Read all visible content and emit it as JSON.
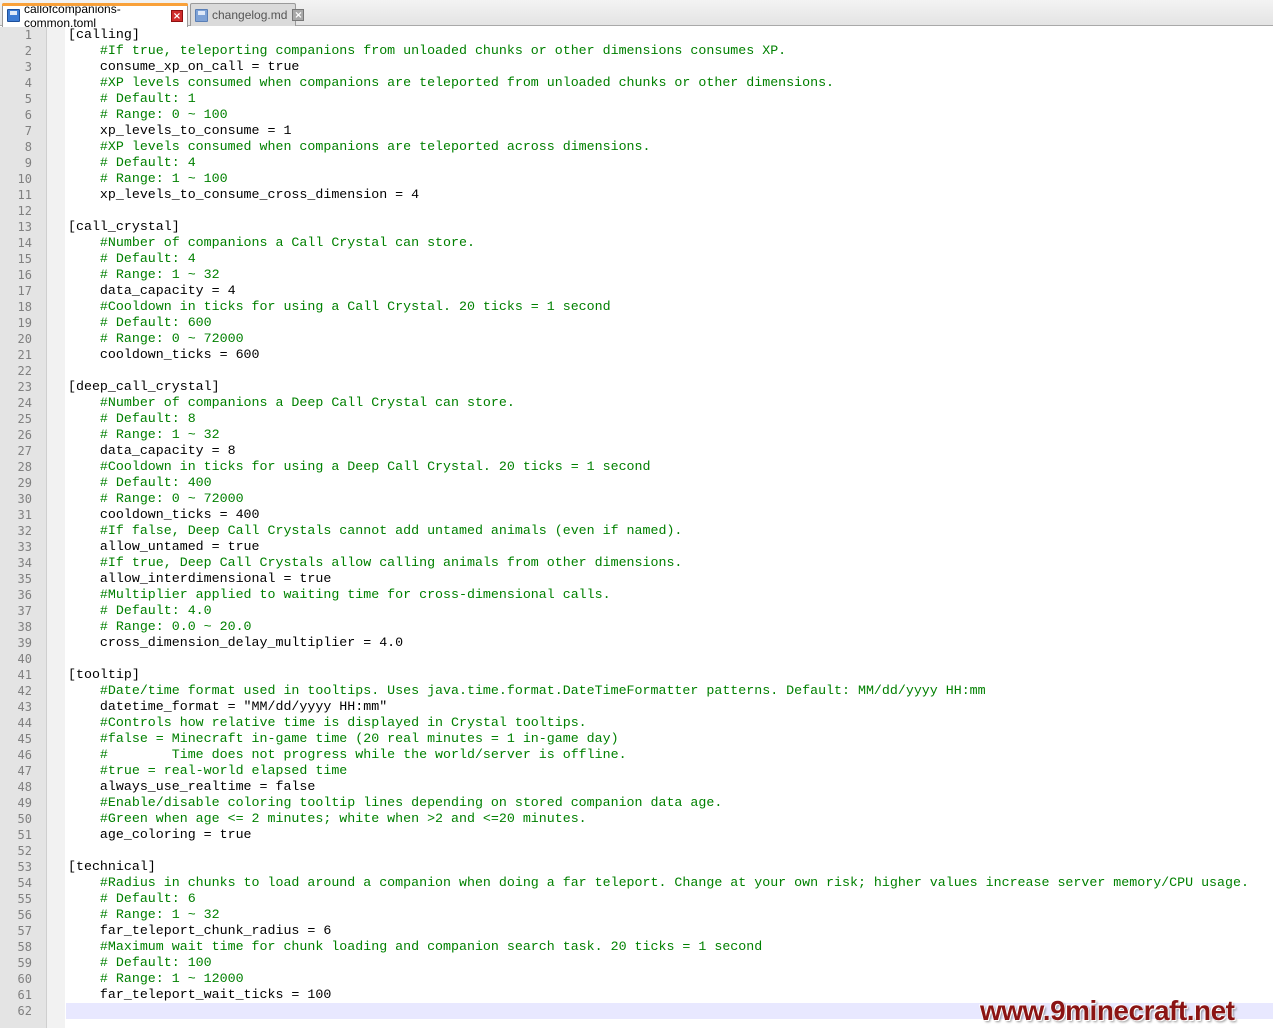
{
  "tabs": [
    {
      "label": "callofcompanions-common.toml",
      "active": true
    },
    {
      "label": "changelog.md",
      "active": false
    }
  ],
  "colors": {
    "comment": "#008000",
    "text": "#000000",
    "line_number": "#808080",
    "current_line": "#e8e8ff",
    "watermark": "#8b1414"
  },
  "current_line": 62,
  "lines": [
    {
      "n": "1",
      "text": "[calling]",
      "comment": false
    },
    {
      "n": "2",
      "text": "    #If true, teleporting companions from unloaded chunks or other dimensions consumes XP.",
      "comment": true
    },
    {
      "n": "3",
      "text": "    consume_xp_on_call = true",
      "comment": false
    },
    {
      "n": "4",
      "text": "    #XP levels consumed when companions are teleported from unloaded chunks or other dimensions.",
      "comment": true
    },
    {
      "n": "5",
      "text": "    # Default: 1",
      "comment": true
    },
    {
      "n": "6",
      "text": "    # Range: 0 ~ 100",
      "comment": true
    },
    {
      "n": "7",
      "text": "    xp_levels_to_consume = 1",
      "comment": false
    },
    {
      "n": "8",
      "text": "    #XP levels consumed when companions are teleported across dimensions.",
      "comment": true
    },
    {
      "n": "9",
      "text": "    # Default: 4",
      "comment": true
    },
    {
      "n": "10",
      "text": "    # Range: 1 ~ 100",
      "comment": true
    },
    {
      "n": "11",
      "text": "    xp_levels_to_consume_cross_dimension = 4",
      "comment": false
    },
    {
      "n": "12",
      "text": "",
      "comment": false
    },
    {
      "n": "13",
      "text": "[call_crystal]",
      "comment": false
    },
    {
      "n": "14",
      "text": "    #Number of companions a Call Crystal can store.",
      "comment": true
    },
    {
      "n": "15",
      "text": "    # Default: 4",
      "comment": true
    },
    {
      "n": "16",
      "text": "    # Range: 1 ~ 32",
      "comment": true
    },
    {
      "n": "17",
      "text": "    data_capacity = 4",
      "comment": false
    },
    {
      "n": "18",
      "text": "    #Cooldown in ticks for using a Call Crystal. 20 ticks = 1 second",
      "comment": true
    },
    {
      "n": "19",
      "text": "    # Default: 600",
      "comment": true
    },
    {
      "n": "20",
      "text": "    # Range: 0 ~ 72000",
      "comment": true
    },
    {
      "n": "21",
      "text": "    cooldown_ticks = 600",
      "comment": false
    },
    {
      "n": "22",
      "text": "",
      "comment": false
    },
    {
      "n": "23",
      "text": "[deep_call_crystal]",
      "comment": false
    },
    {
      "n": "24",
      "text": "    #Number of companions a Deep Call Crystal can store.",
      "comment": true
    },
    {
      "n": "25",
      "text": "    # Default: 8",
      "comment": true
    },
    {
      "n": "26",
      "text": "    # Range: 1 ~ 32",
      "comment": true
    },
    {
      "n": "27",
      "text": "    data_capacity = 8",
      "comment": false
    },
    {
      "n": "28",
      "text": "    #Cooldown in ticks for using a Deep Call Crystal. 20 ticks = 1 second",
      "comment": true
    },
    {
      "n": "29",
      "text": "    # Default: 400",
      "comment": true
    },
    {
      "n": "30",
      "text": "    # Range: 0 ~ 72000",
      "comment": true
    },
    {
      "n": "31",
      "text": "    cooldown_ticks = 400",
      "comment": false
    },
    {
      "n": "32",
      "text": "    #If false, Deep Call Crystals cannot add untamed animals (even if named).",
      "comment": true
    },
    {
      "n": "33",
      "text": "    allow_untamed = true",
      "comment": false
    },
    {
      "n": "34",
      "text": "    #If true, Deep Call Crystals allow calling animals from other dimensions.",
      "comment": true
    },
    {
      "n": "35",
      "text": "    allow_interdimensional = true",
      "comment": false
    },
    {
      "n": "36",
      "text": "    #Multiplier applied to waiting time for cross-dimensional calls.",
      "comment": true
    },
    {
      "n": "37",
      "text": "    # Default: 4.0",
      "comment": true
    },
    {
      "n": "38",
      "text": "    # Range: 0.0 ~ 20.0",
      "comment": true
    },
    {
      "n": "39",
      "text": "    cross_dimension_delay_multiplier = 4.0",
      "comment": false
    },
    {
      "n": "40",
      "text": "",
      "comment": false
    },
    {
      "n": "41",
      "text": "[tooltip]",
      "comment": false
    },
    {
      "n": "42",
      "text": "    #Date/time format used in tooltips. Uses java.time.format.DateTimeFormatter patterns. Default: MM/dd/yyyy HH:mm",
      "comment": true
    },
    {
      "n": "43",
      "text": "    datetime_format = \"MM/dd/yyyy HH:mm\"",
      "comment": false
    },
    {
      "n": "44",
      "text": "    #Controls how relative time is displayed in Crystal tooltips.",
      "comment": true
    },
    {
      "n": "45",
      "text": "    #false = Minecraft in-game time (20 real minutes = 1 in-game day)",
      "comment": true
    },
    {
      "n": "46",
      "text": "    #        Time does not progress while the world/server is offline.",
      "comment": true
    },
    {
      "n": "47",
      "text": "    #true = real-world elapsed time",
      "comment": true
    },
    {
      "n": "48",
      "text": "    always_use_realtime = false",
      "comment": false
    },
    {
      "n": "49",
      "text": "    #Enable/disable coloring tooltip lines depending on stored companion data age.",
      "comment": true
    },
    {
      "n": "50",
      "text": "    #Green when age <= 2 minutes; white when >2 and <=20 minutes.",
      "comment": true
    },
    {
      "n": "51",
      "text": "    age_coloring = true",
      "comment": false
    },
    {
      "n": "52",
      "text": "",
      "comment": false
    },
    {
      "n": "53",
      "text": "[technical]",
      "comment": false
    },
    {
      "n": "54",
      "text": "    #Radius in chunks to load around a companion when doing a far teleport. Change at your own risk; higher values increase server memory/CPU usage.",
      "comment": true
    },
    {
      "n": "55",
      "text": "    # Default: 6",
      "comment": true
    },
    {
      "n": "56",
      "text": "    # Range: 1 ~ 32",
      "comment": true
    },
    {
      "n": "57",
      "text": "    far_teleport_chunk_radius = 6",
      "comment": false
    },
    {
      "n": "58",
      "text": "    #Maximum wait time for chunk loading and companion search task. 20 ticks = 1 second",
      "comment": true
    },
    {
      "n": "59",
      "text": "    # Default: 100",
      "comment": true
    },
    {
      "n": "60",
      "text": "    # Range: 1 ~ 12000",
      "comment": true
    },
    {
      "n": "61",
      "text": "    far_teleport_wait_ticks = 100",
      "comment": false
    },
    {
      "n": "62",
      "text": "",
      "comment": false
    }
  ],
  "watermark": "www.9minecraft.net"
}
